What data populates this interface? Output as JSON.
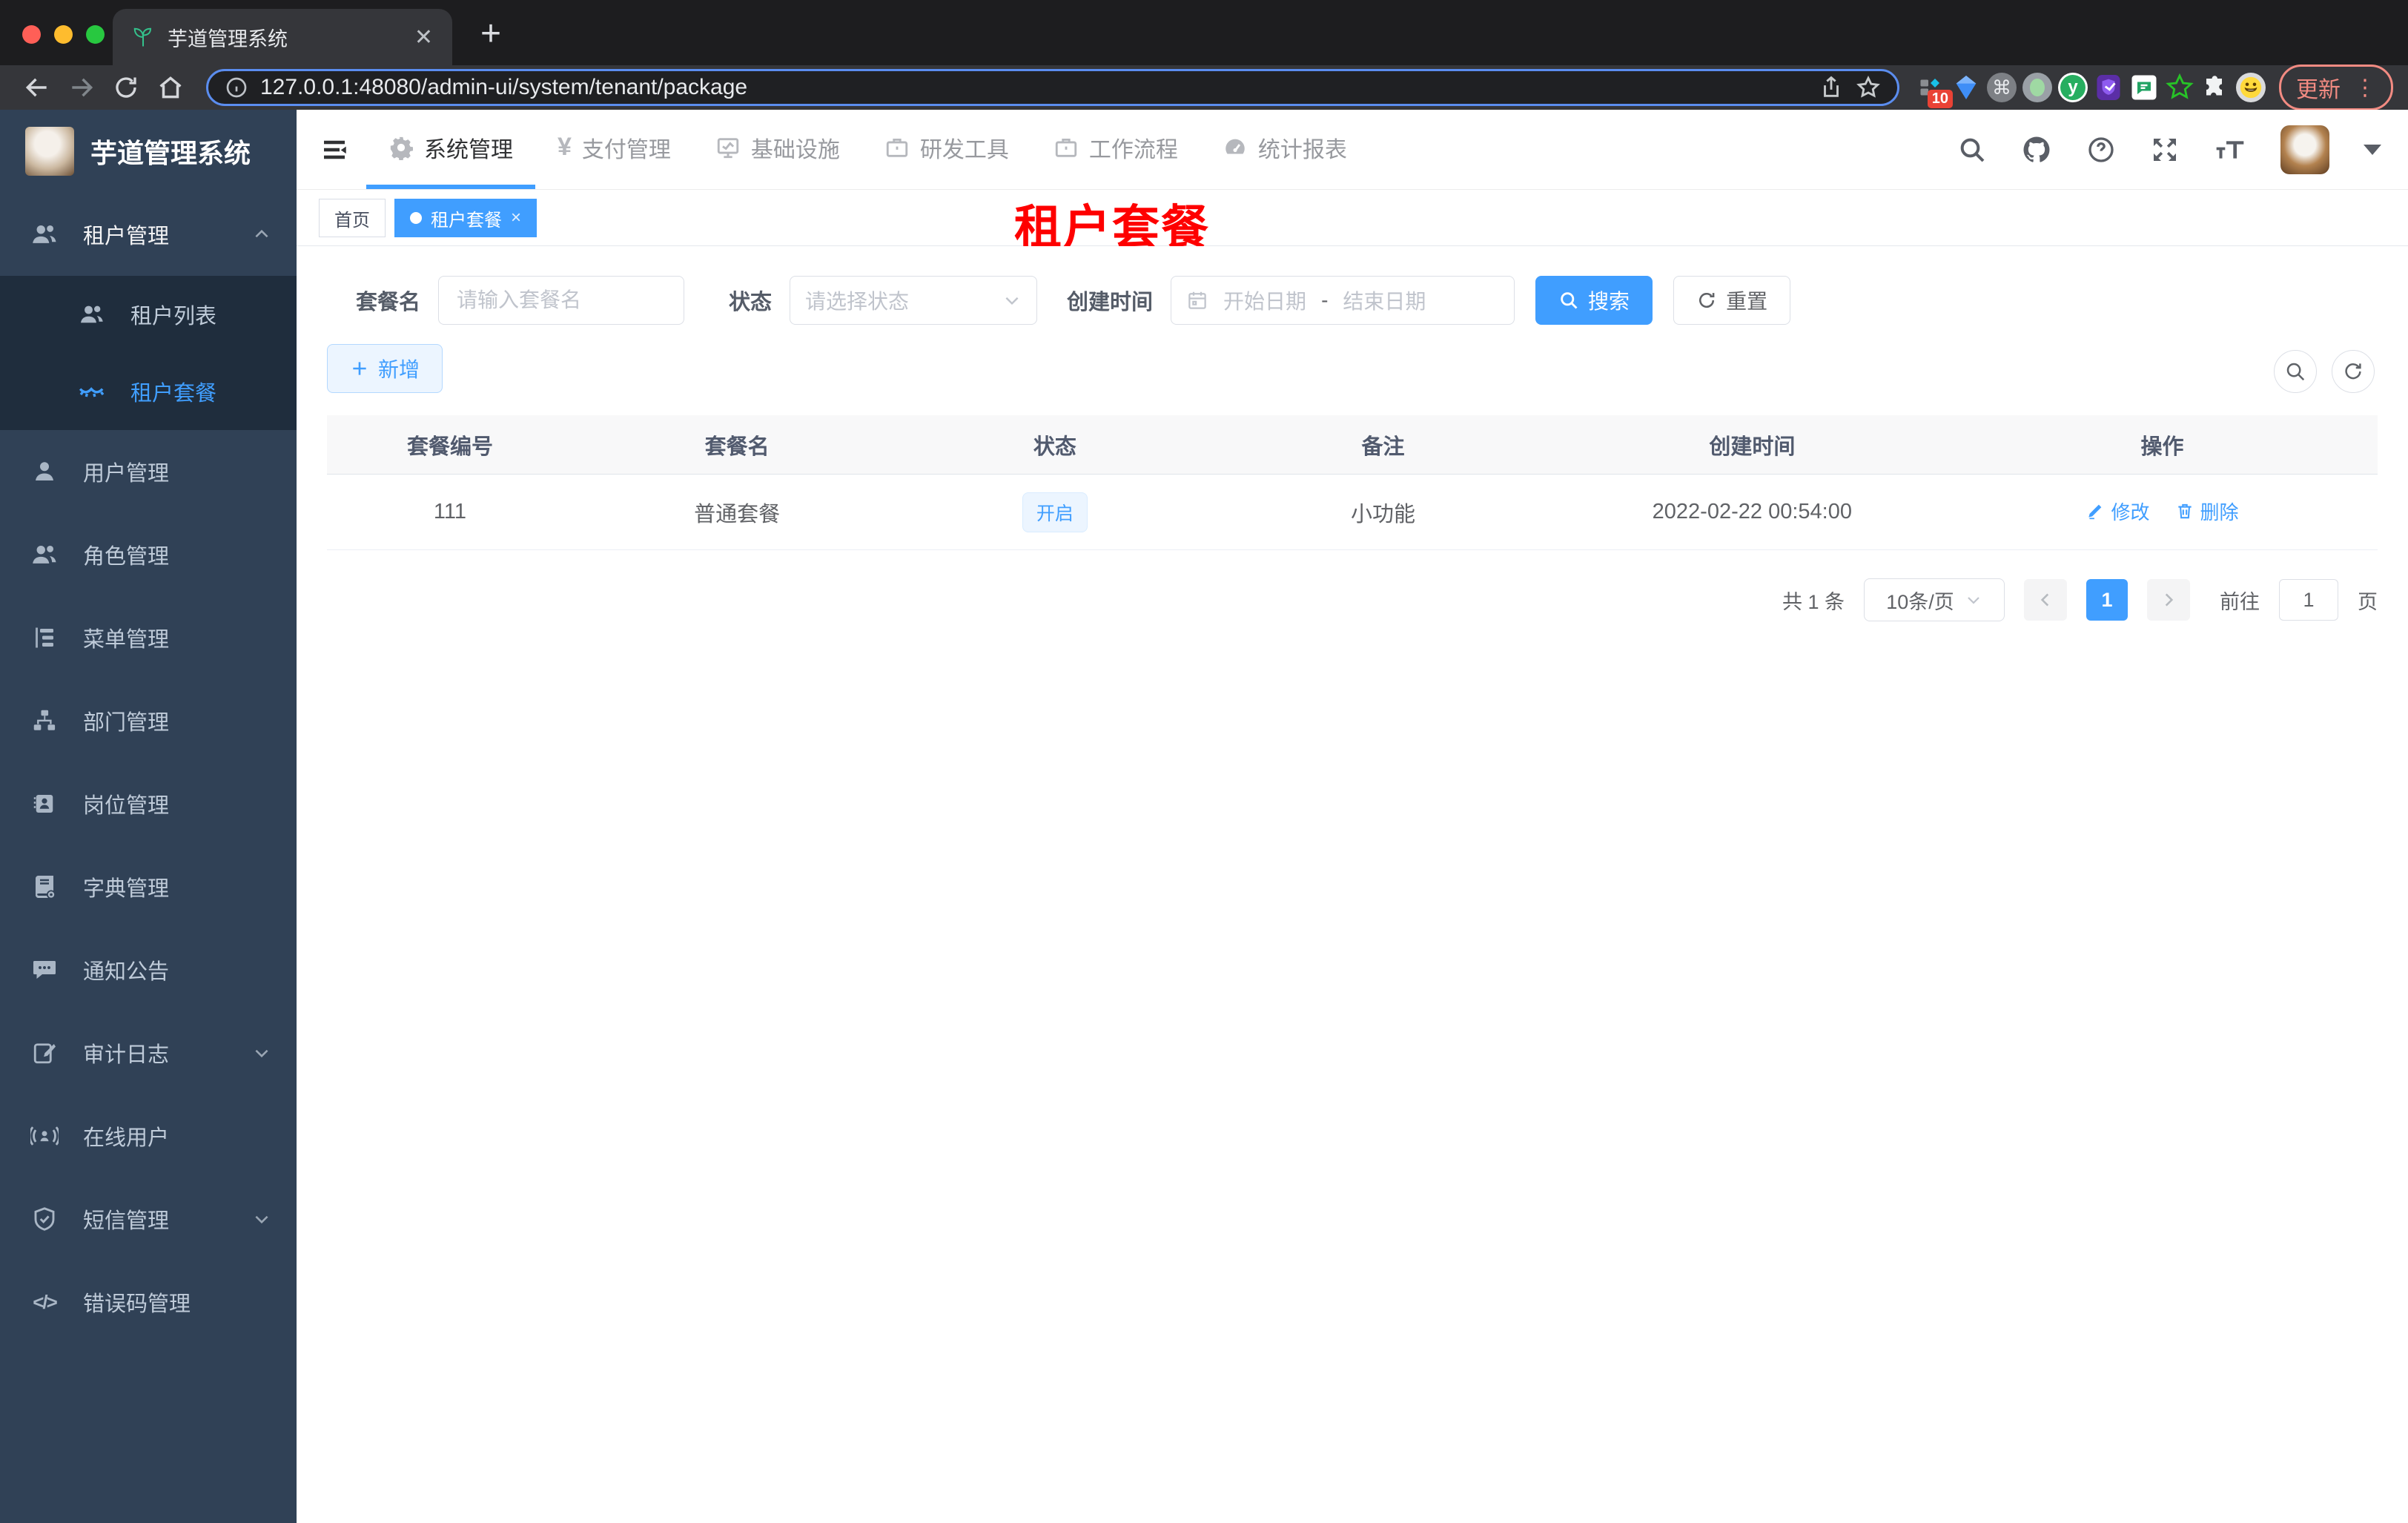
{
  "browser": {
    "tab_title": "芋道管理系统",
    "url": "127.0.0.1:48080/admin-ui/system/tenant/package",
    "extension_badge": "10",
    "update_label": "更新"
  },
  "colors": {
    "accent": "#409EFF",
    "sidebar_bg": "#304156",
    "submenu_bg": "#1F2D3D",
    "annotation": "#FE0000"
  },
  "sidebar": {
    "logo_title": "芋道管理系统",
    "items": [
      {
        "label": "租户管理"
      },
      {
        "label": "租户列表"
      },
      {
        "label": "租户套餐"
      },
      {
        "label": "用户管理"
      },
      {
        "label": "角色管理"
      },
      {
        "label": "菜单管理"
      },
      {
        "label": "部门管理"
      },
      {
        "label": "岗位管理"
      },
      {
        "label": "字典管理"
      },
      {
        "label": "通知公告"
      },
      {
        "label": "审计日志"
      },
      {
        "label": "在线用户"
      },
      {
        "label": "短信管理"
      },
      {
        "label": "错误码管理"
      }
    ]
  },
  "topnav": {
    "items": [
      {
        "label": "系统管理"
      },
      {
        "label": "支付管理"
      },
      {
        "label": "基础设施"
      },
      {
        "label": "研发工具"
      },
      {
        "label": "工作流程"
      },
      {
        "label": "统计报表"
      }
    ]
  },
  "tags": {
    "home": "首页",
    "active": "租户套餐"
  },
  "overlay": {
    "label": "租户套餐"
  },
  "filters": {
    "name_label": "套餐名",
    "name_placeholder": "请输入套餐名",
    "status_label": "状态",
    "status_placeholder": "请选择状态",
    "date_label": "创建时间",
    "date_start": "开始日期",
    "date_sep": "-",
    "date_end": "结束日期",
    "search_label": "搜索",
    "reset_label": "重置"
  },
  "toolbar": {
    "add_label": "新增"
  },
  "table": {
    "headers": [
      "套餐编号",
      "套餐名",
      "状态",
      "备注",
      "创建时间",
      "操作"
    ],
    "rows": [
      {
        "id": "111",
        "name": "普通套餐",
        "status": "开启",
        "remark": "小功能",
        "created": "2022-02-22 00:54:00",
        "edit": "修改",
        "delete": "删除"
      }
    ]
  },
  "pagination": {
    "total": "共 1 条",
    "per_page": "10条/页",
    "page": "1",
    "goto_label": "前往",
    "goto_value": "1",
    "unit_label": "页"
  }
}
